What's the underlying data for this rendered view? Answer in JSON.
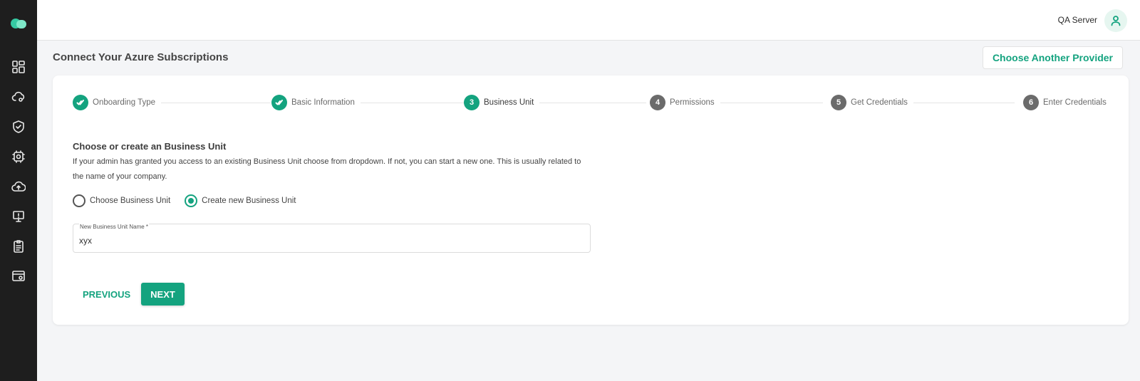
{
  "header": {
    "user_name": "QA Server"
  },
  "sidebar": {
    "items": [
      {
        "icon": "dashboard-icon"
      },
      {
        "icon": "cloud-settings-icon"
      },
      {
        "icon": "shield-check-icon"
      },
      {
        "icon": "cpu-chip-icon"
      },
      {
        "icon": "cloud-upload-icon"
      },
      {
        "icon": "monitor-alert-icon"
      },
      {
        "icon": "clipboard-list-icon"
      },
      {
        "icon": "browser-settings-icon"
      }
    ]
  },
  "page": {
    "title": "Connect Your Azure Subscriptions",
    "provider_button": "Choose Another Provider"
  },
  "stepper": {
    "steps": [
      {
        "number": "1",
        "label": "Onboarding Type",
        "state": "done"
      },
      {
        "number": "2",
        "label": "Basic Information",
        "state": "done"
      },
      {
        "number": "3",
        "label": "Business Unit",
        "state": "active"
      },
      {
        "number": "4",
        "label": "Permissions",
        "state": "pending"
      },
      {
        "number": "5",
        "label": "Get Credentials",
        "state": "pending"
      },
      {
        "number": "6",
        "label": "Enter Credentials",
        "state": "pending"
      }
    ]
  },
  "business_unit": {
    "title": "Choose or create an Business Unit",
    "description": "If your admin has granted you access to an existing Business Unit choose from dropdown. If not, you can start a new one. This is usually related to the name of your company.",
    "options": [
      {
        "label": "Choose Business Unit",
        "selected": false
      },
      {
        "label": "Create new Business Unit",
        "selected": true
      }
    ],
    "field_label": "New Business Unit Name *",
    "field_value": "xyx"
  },
  "actions": {
    "previous": "PREVIOUS",
    "next": "NEXT"
  },
  "colors": {
    "accent": "#14a37f",
    "sidebar_bg": "#1e1e1e",
    "pending_step": "#6b6b6b"
  }
}
